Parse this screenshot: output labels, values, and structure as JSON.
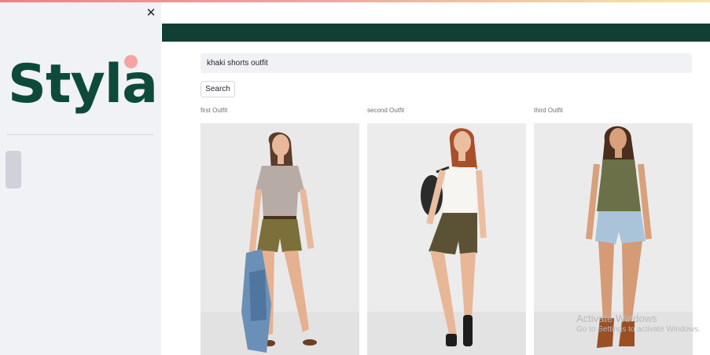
{
  "app": {
    "logo_text": "Styla"
  },
  "search": {
    "value": "khaki shorts outfit",
    "button_label": "Search"
  },
  "outfits": [
    {
      "caption": "first Outfit"
    },
    {
      "caption": "second Outfit"
    },
    {
      "caption": "third Outfit"
    }
  ],
  "watermark": {
    "line1": "Activate Windows",
    "line2": "Go to Settings to activate Windows."
  },
  "icons": {
    "close": "close-icon"
  },
  "colors": {
    "brand_green": "#0e4a3b",
    "brand_dot": "#f5a3a3",
    "header_band": "#123f33",
    "sidebar_bg": "#f0f2f6"
  }
}
